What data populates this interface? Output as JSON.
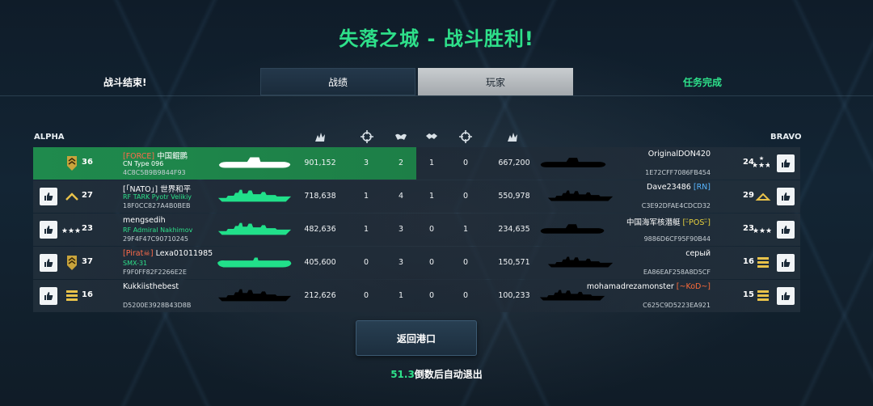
{
  "title": "失落之城 - 战斗胜利!",
  "topbar": {
    "battle_end": "战斗结束!",
    "tabs": [
      {
        "label": "战绩",
        "active": false
      },
      {
        "label": "玩家",
        "active": true
      }
    ],
    "mission": "任务完成"
  },
  "teams": {
    "alpha": "ALPHA",
    "bravo": "BRAVO"
  },
  "colors": {
    "accent_green": "#2ee08a",
    "highlight": "#1f8a4d",
    "ship_green": "#21e08a"
  },
  "column_icons": [
    "damage-icon",
    "crosshair-icon",
    "assist-icon",
    "handshake-icon",
    "crosshair-icon",
    "damage-icon"
  ],
  "alpha": [
    {
      "tag": "[FORCE]",
      "name": "中国鲲鹏",
      "ship": "CN Type 096",
      "id": "4C8C5B9B9844F93",
      "level": "36",
      "rank": "sergeant",
      "damage": "901,152",
      "kills": "3",
      "assists": "2",
      "highlight": true
    },
    {
      "tag": "",
      "name": "[「NATO」] 世界和平",
      "ship": "RF TARK Pyotr Velikiy",
      "id": "18F0CC827A4B0BEB",
      "level": "27",
      "rank": "chevron",
      "damage": "718,638",
      "kills": "1",
      "assists": "4",
      "highlight": false
    },
    {
      "tag": "",
      "name": "mengsedih",
      "ship": "RF Admiral Nakhimov",
      "id": "29F4F47C90710245",
      "level": "23",
      "rank": "stars",
      "damage": "482,636",
      "kills": "1",
      "assists": "3",
      "highlight": false
    },
    {
      "tag": "[Pirat☠]",
      "name": "Lexa01011985",
      "ship": "SMX-31",
      "id": "F9F0FF82F2266E2E",
      "level": "37",
      "rank": "sergeant",
      "damage": "405,600",
      "kills": "0",
      "assists": "3",
      "highlight": false
    },
    {
      "tag": "",
      "name": "Kukkiisthebest",
      "ship": "",
      "id": "D5200E3928B43D8B",
      "level": "16",
      "rank": "bars",
      "damage": "212,626",
      "kills": "0",
      "assists": "1",
      "highlight": false
    }
  ],
  "bravo": [
    {
      "tag": "",
      "name": "OriginalDON420",
      "ship": "",
      "id": "1E72CFF7086FB454",
      "level": "24",
      "rank": "stars",
      "col1": "1",
      "col2": "0",
      "damage": "667,200"
    },
    {
      "tag": "[RN]",
      "name": "Dave23486",
      "ship": "",
      "id": "C3E92DFAE4CDCD32",
      "level": "29",
      "rank": "chevron",
      "col1": "1",
      "col2": "0",
      "damage": "550,978"
    },
    {
      "tag": "[ᵕ̈POSᵕ̈]",
      "name": "中国海军核潜艇",
      "ship": "",
      "id": "9886D6CF95F90B44",
      "level": "23",
      "rank": "stars",
      "col1": "0",
      "col2": "1",
      "damage": "234,635"
    },
    {
      "tag": "",
      "name": "серый",
      "ship": "",
      "id": "EA86EAF258A8D5CF",
      "level": "16",
      "rank": "bars",
      "col1": "0",
      "col2": "0",
      "damage": "150,571"
    },
    {
      "tag": "[~KoD~]",
      "name": "mohamadrezamonster",
      "ship": "",
      "id": "C625C9D5223EA921",
      "level": "15",
      "rank": "bars",
      "col1": "0",
      "col2": "0",
      "damage": "100,233"
    }
  ],
  "return_button": "返回港口",
  "countdown": {
    "value": "51.3",
    "text": "倒数后自动退出"
  }
}
